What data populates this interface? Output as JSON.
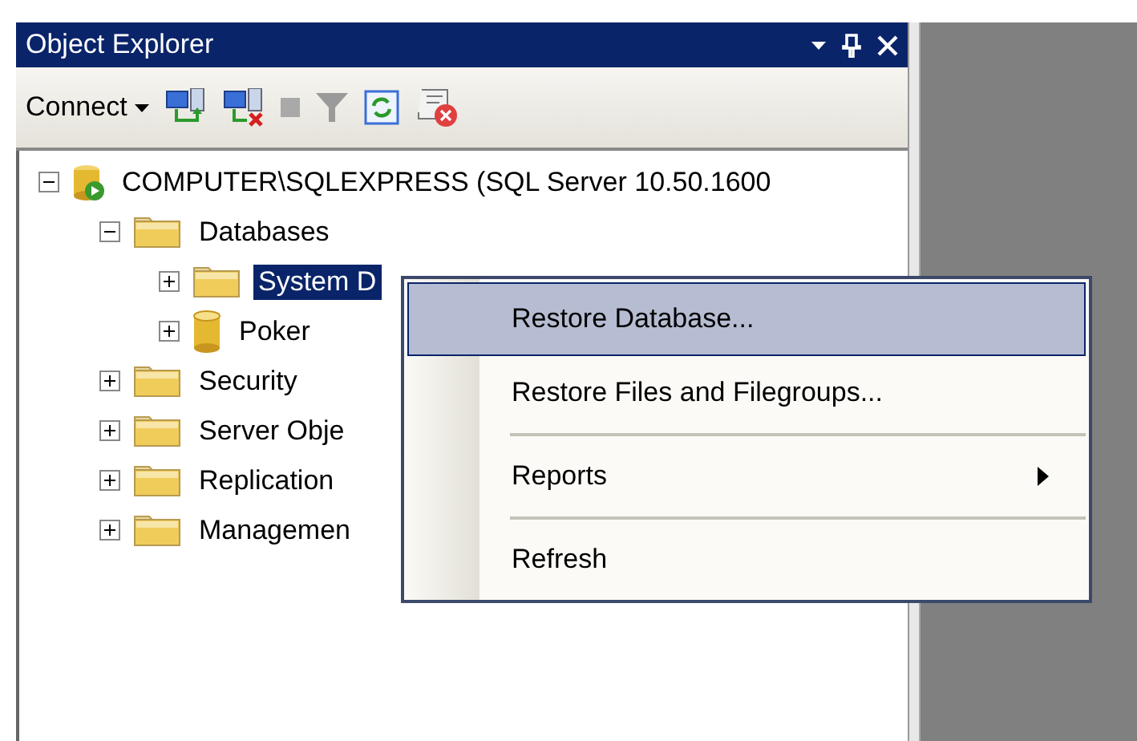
{
  "window": {
    "title": "Object Explorer"
  },
  "toolbar": {
    "connect_label": "Connect"
  },
  "tree": [
    {
      "label": "COMPUTER\\SQLEXPRESS (SQL Server 10.50.1600",
      "kind": "server",
      "expanded": true,
      "selected": false,
      "children": [
        {
          "label": "Databases",
          "kind": "folder",
          "expanded": true,
          "selected": false,
          "children": [
            {
              "label": "System D",
              "kind": "folder",
              "expanded": false,
              "selected": true
            },
            {
              "label": "Poker",
              "kind": "database",
              "expanded": false,
              "selected": false
            }
          ]
        },
        {
          "label": "Security",
          "kind": "folder",
          "expanded": false,
          "selected": false
        },
        {
          "label": "Server Obje",
          "kind": "folder",
          "expanded": false,
          "selected": false
        },
        {
          "label": "Replication",
          "kind": "folder",
          "expanded": false,
          "selected": false
        },
        {
          "label": "Managemen",
          "kind": "folder",
          "expanded": false,
          "selected": false
        }
      ]
    }
  ],
  "context_menu": {
    "items": [
      {
        "kind": "item",
        "label": "Restore Database...",
        "selected": true,
        "submenu": false
      },
      {
        "kind": "item",
        "label": "Restore Files and Filegroups...",
        "selected": false,
        "submenu": false
      },
      {
        "kind": "separator"
      },
      {
        "kind": "item",
        "label": "Reports",
        "selected": false,
        "submenu": true
      },
      {
        "kind": "separator"
      },
      {
        "kind": "item",
        "label": "Refresh",
        "selected": false,
        "submenu": false
      }
    ]
  }
}
